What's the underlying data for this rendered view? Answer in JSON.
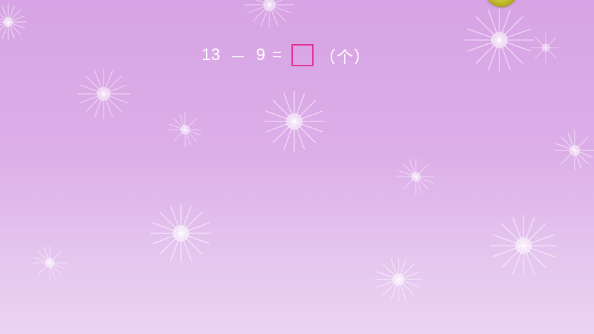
{
  "equation": {
    "left_operand": "13",
    "operator": "－",
    "right_operand": "9",
    "equals": "=",
    "answer_placeholder": "",
    "unit": "（个）"
  },
  "colors": {
    "background_top": "#d7a3e4",
    "background_bottom": "#ebd3f2",
    "text": "#ffffff",
    "answer_box_border": "#e0308c",
    "corner_ball": "#c8c030"
  },
  "icons": [
    "sparkle-icon",
    "corner-ball-icon"
  ]
}
